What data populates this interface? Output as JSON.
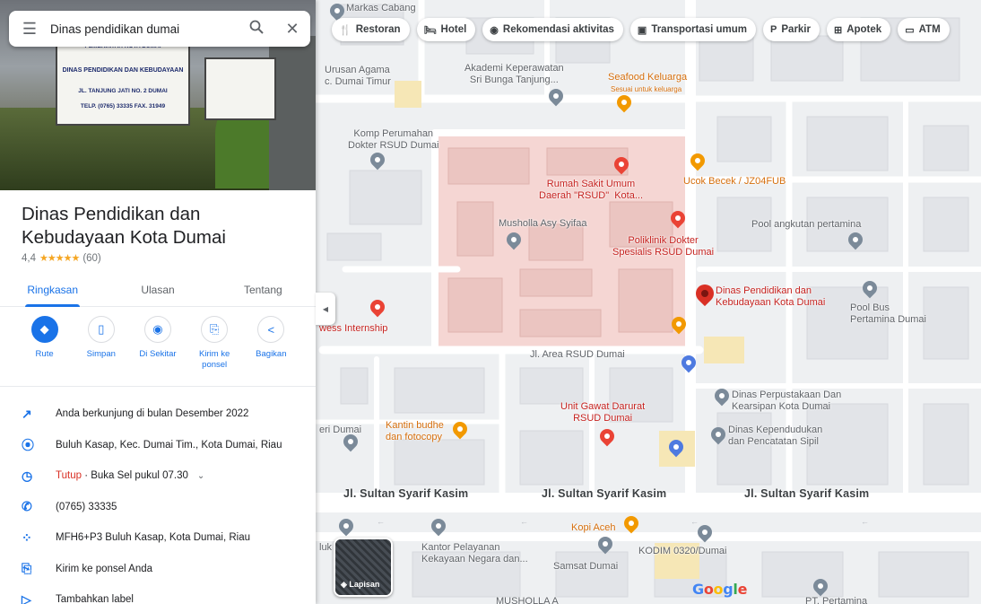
{
  "search": {
    "query": "Dinas pendidikan dumai"
  },
  "place": {
    "hero_sign_texts": [
      "PEMERINTAH KOTA DUMAI",
      "DINAS PENDIDIKAN DAN KEBUDAYAAN",
      "JL. TANJUNG JATI NO. 2 DUMAI",
      "TELP. (0765) 33335 FAX. 31949"
    ],
    "title": "Dinas Pendidikan dan Kebudayaan Kota Dumai",
    "rating": "4,4",
    "stars": "★★★★★",
    "review_count": "(60)"
  },
  "tabs": [
    "Ringkasan",
    "Ulasan",
    "Tentang"
  ],
  "actions": [
    {
      "label": "Rute",
      "icon": "directions-icon"
    },
    {
      "label": "Simpan",
      "icon": "bookmark-icon"
    },
    {
      "label": "Di Sekitar",
      "icon": "nearby-icon"
    },
    {
      "label": "Kirim ke ponsel",
      "icon": "send-to-phone-icon"
    },
    {
      "label": "Bagikan",
      "icon": "share-icon"
    }
  ],
  "info": {
    "popular_times": "Anda berkunjung di bulan Desember 2022",
    "address": "Buluh Kasap, Kec. Dumai Tim., Kota Dumai, Riau",
    "hours_status": "Tutup",
    "hours_detail": "· Buka Sel pukul 07.30",
    "phone": "(0765) 33335",
    "plus_code": "MFH6+P3 Buluh Kasap, Kota Dumai, Riau",
    "send_to_phone": "Kirim ke ponsel Anda",
    "add_label": "Tambahkan label"
  },
  "chips": [
    {
      "label": "Restoran",
      "icon": "restaurant-icon",
      "glyph": "🍴"
    },
    {
      "label": "Hotel",
      "icon": "hotel-icon",
      "glyph": "🛏"
    },
    {
      "label": "Rekomendasi aktivitas",
      "icon": "camera-icon",
      "glyph": "◉"
    },
    {
      "label": "Transportasi umum",
      "icon": "bus-icon",
      "glyph": "▣"
    },
    {
      "label": "Parkir",
      "icon": "parking-icon",
      "glyph": "P"
    },
    {
      "label": "Apotek",
      "icon": "pharmacy-icon",
      "glyph": "⊞"
    },
    {
      "label": "ATM",
      "icon": "atm-icon",
      "glyph": "▭"
    }
  ],
  "map_labels": {
    "markas": "Markas Cabang",
    "urusan": "Urusan Agama\nc. Dumai Timur",
    "akademi": "Akademi Keperawatan\nSri Bunga Tanjung...",
    "seafood": "Seafood Keluarga",
    "seafood_sub": "Sesuai untuk keluarga",
    "komp": "Komp Perumahan\nDokter RSUD Dumai",
    "rsud": "Rumah Sakit Umum\nDaerah \"RSUD\"  Kota...",
    "ucok": "Ucok Becek / JZ04FUB",
    "musholla": "Musholla Asy Syifaa",
    "poliklinik": "Poliklinik Dokter\nSpesialis RSUD Dumai",
    "pool_angkutan": "Pool angkutan pertamina",
    "dinas_pin": "Dinas Pendidikan dan\nKebudayaan Kota Dumai",
    "pool_bus": "Pool Bus\nPertamina Dumai",
    "internship": "wess Internship",
    "area_rsud": "Jl. Area RSUD Dumai",
    "perpustakaan": "Dinas Perpustakaan Dan\nKearsipan Kota Dumai",
    "ugd": "Unit Gawat Darurat\nRSUD Dumai",
    "kantin": "Kantin budhe\ndan fotocopy",
    "eri": "eri Dumai",
    "kependudukan": "Dinas Kependudukan\ndan Pencatatan Sipil",
    "road1": "Jl. Sultan Syarif Kasim",
    "road2": "Jl. Sultan Syarif Kasim",
    "road3": "Jl. Sultan Syarif Kasim",
    "kopi": "Kopi Aceh",
    "kantor": "Kantor Pelayanan\nKekayaan Negara dan...",
    "kodim": "KODIM 0320/Dumai",
    "samsat": "Samsat Dumai",
    "pluk": "luk",
    "mushola_bottom": "MUSHOLLA A",
    "pt": "PT. Pertamina"
  },
  "layers_label": "Lapisan",
  "google": "Google"
}
